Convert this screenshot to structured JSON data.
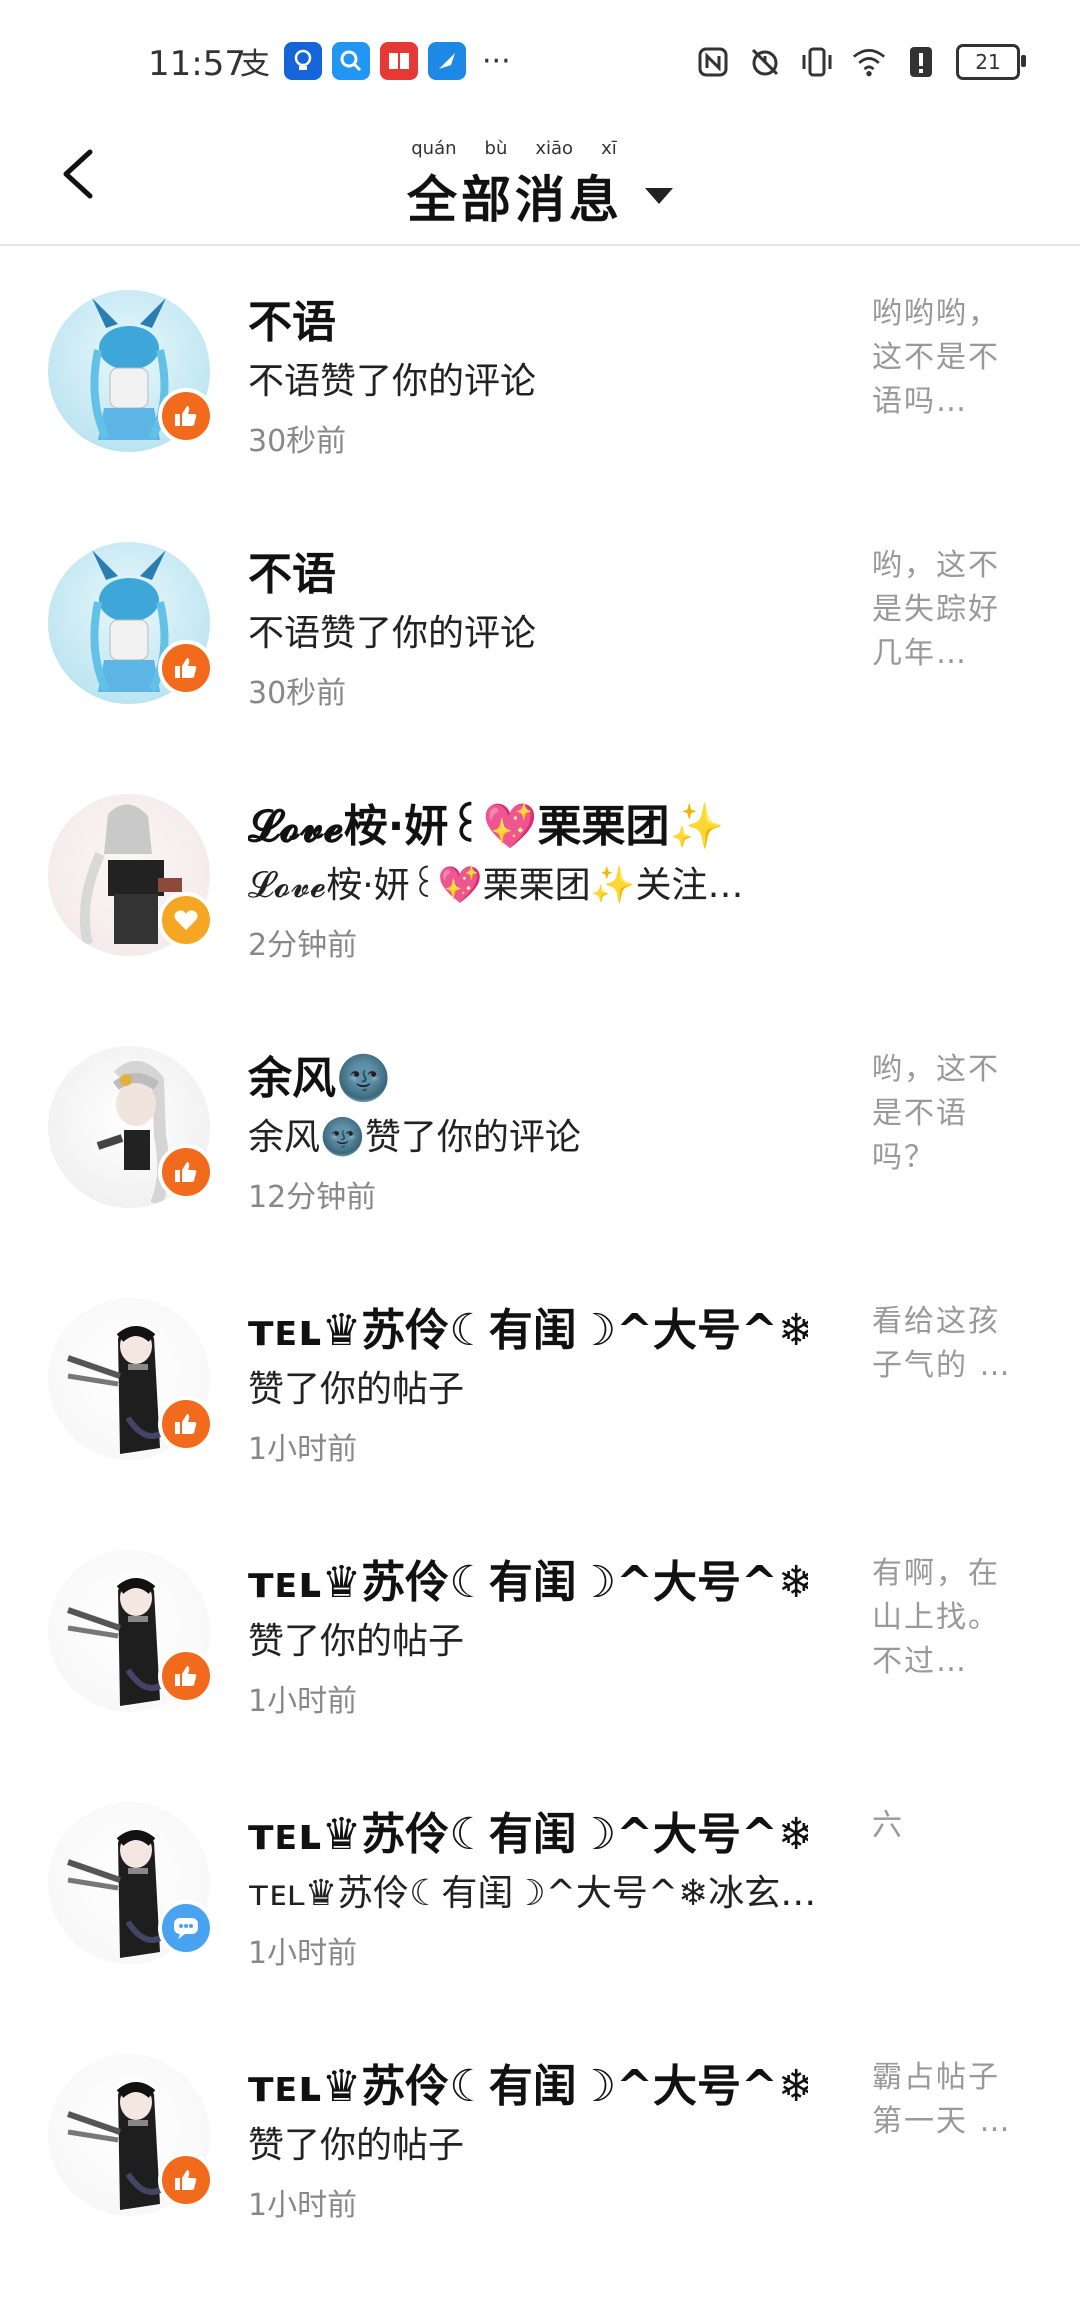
{
  "status_bar": {
    "time": "11:57",
    "apps": [
      {
        "icon": "alipay-icon",
        "color": "#ffffff",
        "glyph": "支"
      },
      {
        "icon": "bulb-icon",
        "color": "#1565d8",
        "glyph": "💡"
      },
      {
        "icon": "search-icon",
        "color": "#2196f3",
        "glyph": "🔍"
      },
      {
        "icon": "book-icon",
        "color": "#e53935",
        "glyph": "📖"
      },
      {
        "icon": "feather-icon",
        "color": "#1e88e5",
        "glyph": "✈"
      }
    ],
    "more": "···",
    "battery": "21"
  },
  "header": {
    "title": "全部消息",
    "pinyin": [
      "quán",
      "bù",
      "xiāo",
      "xī"
    ]
  },
  "messages": [
    {
      "name": "不语",
      "desc": "不语赞了你的评论",
      "time": "30秒前",
      "preview": "哟哟哟，这不是不语吗…",
      "badge": "like",
      "avatar": "blue"
    },
    {
      "name": "不语",
      "desc": "不语赞了你的评论",
      "time": "30秒前",
      "preview": "哟，这不是失踪好几年…",
      "badge": "like",
      "avatar": "blue"
    },
    {
      "name": "𝓛𝓸𝓿𝓮桉·妍꒰💖栗栗团✨",
      "desc": "𝓛𝓸𝓿𝓮桉·妍꒰💖栗栗团✨关注…",
      "time": "2分钟前",
      "preview": "",
      "badge": "heart",
      "avatar": "white"
    },
    {
      "name": "余风🌚",
      "desc": "余风🌚赞了你的评论",
      "time": "12分钟前",
      "preview": "哟，这不是不语吗？",
      "badge": "like",
      "avatar": "silver"
    },
    {
      "name": "ᴛᴇʟ♛苏伶☾有闺☽^大号^❄…",
      "desc": "赞了你的帖子",
      "time": "1小时前",
      "preview": "看给这孩子气的 …",
      "badge": "like",
      "avatar": "dark"
    },
    {
      "name": "ᴛᴇʟ♛苏伶☾有闺☽^大号^❄…",
      "desc": "赞了你的帖子",
      "time": "1小时前",
      "preview": "有啊，在山上找。不过…",
      "badge": "like",
      "avatar": "dark"
    },
    {
      "name": "ᴛᴇʟ♛苏伶☾有闺☽^大号^❄…",
      "desc": "ᴛᴇʟ♛苏伶☾有闺☽^大号^❄冰玄…",
      "time": "1小时前",
      "preview": "六",
      "badge": "comment",
      "avatar": "dark"
    },
    {
      "name": "ᴛᴇʟ♛苏伶☾有闺☽^大号^❄…",
      "desc": "赞了你的帖子",
      "time": "1小时前",
      "preview": "霸占帖子第一天 …",
      "badge": "like",
      "avatar": "dark"
    }
  ],
  "colors": {
    "like_badge": "#f26b1d",
    "heart_badge": "#f5a623",
    "comment_badge": "#4aa3f0"
  }
}
